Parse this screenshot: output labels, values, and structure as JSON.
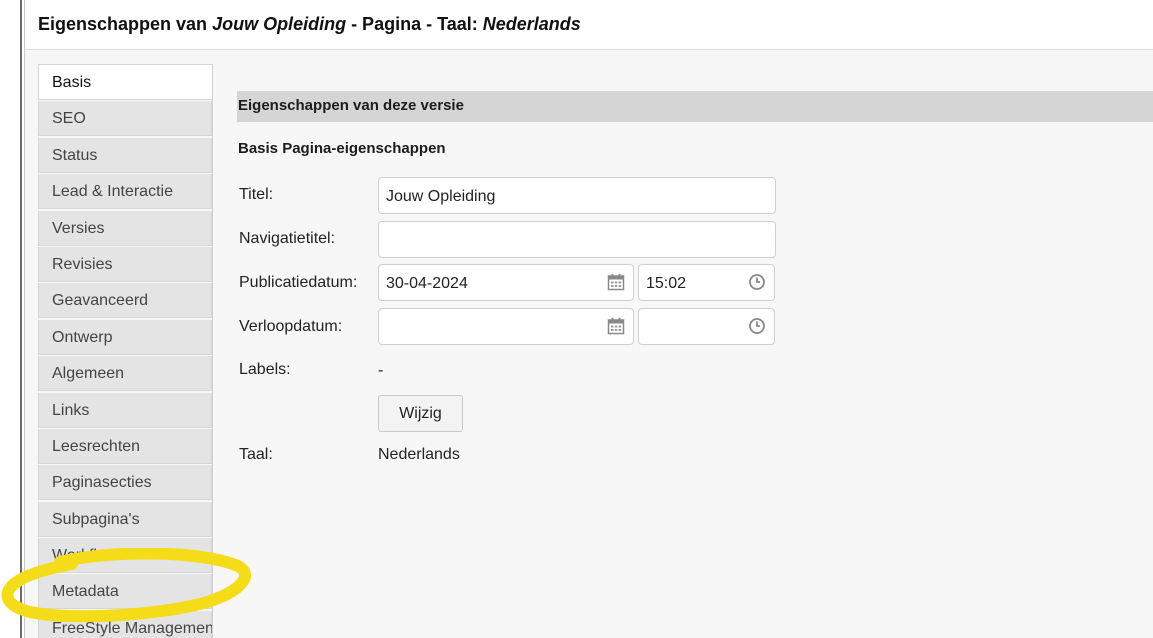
{
  "dialog": {
    "title": {
      "prefix": "Eigenschappen van ",
      "page_name": "Jouw Opleiding",
      "middle": " - Pagina - Taal: ",
      "language": "Nederlands"
    }
  },
  "sidebar": {
    "tabs": [
      {
        "label": "Basis",
        "active": true
      },
      {
        "label": "SEO"
      },
      {
        "label": "Status"
      },
      {
        "label": "Lead & Interactie"
      },
      {
        "label": "Versies"
      },
      {
        "label": "Revisies"
      },
      {
        "label": "Geavanceerd"
      },
      {
        "label": "Ontwerp"
      },
      {
        "label": "Algemeen"
      },
      {
        "label": "Links"
      },
      {
        "label": "Leesrechten"
      },
      {
        "label": "Paginasecties"
      },
      {
        "label": "Subpagina's"
      },
      {
        "label": "Workflow"
      },
      {
        "label": "Metadata"
      },
      {
        "label": "FreeStyle Managemen"
      }
    ]
  },
  "main": {
    "section_title": "Eigenschappen van deze versie",
    "subheading": "Basis Pagina-eigenschappen",
    "fields": {
      "title_label": "Titel:",
      "title_value": "Jouw Opleiding",
      "nav_title_label": "Navigatietitel:",
      "nav_title_value": "",
      "pub_date_label": "Publicatiedatum:",
      "pub_date_value": "30-04-2024",
      "pub_time_value": "15:02",
      "exp_date_label": "Verloopdatum:",
      "exp_date_value": "",
      "exp_time_value": "",
      "labels_label": "Labels:",
      "labels_value": "-",
      "change_button": "Wijzig",
      "language_label": "Taal:",
      "language_value": "Nederlands"
    }
  },
  "annotation": {
    "color": "#f5dc18"
  },
  "icons": {
    "date": "calendar-icon",
    "time": "clock-icon"
  }
}
